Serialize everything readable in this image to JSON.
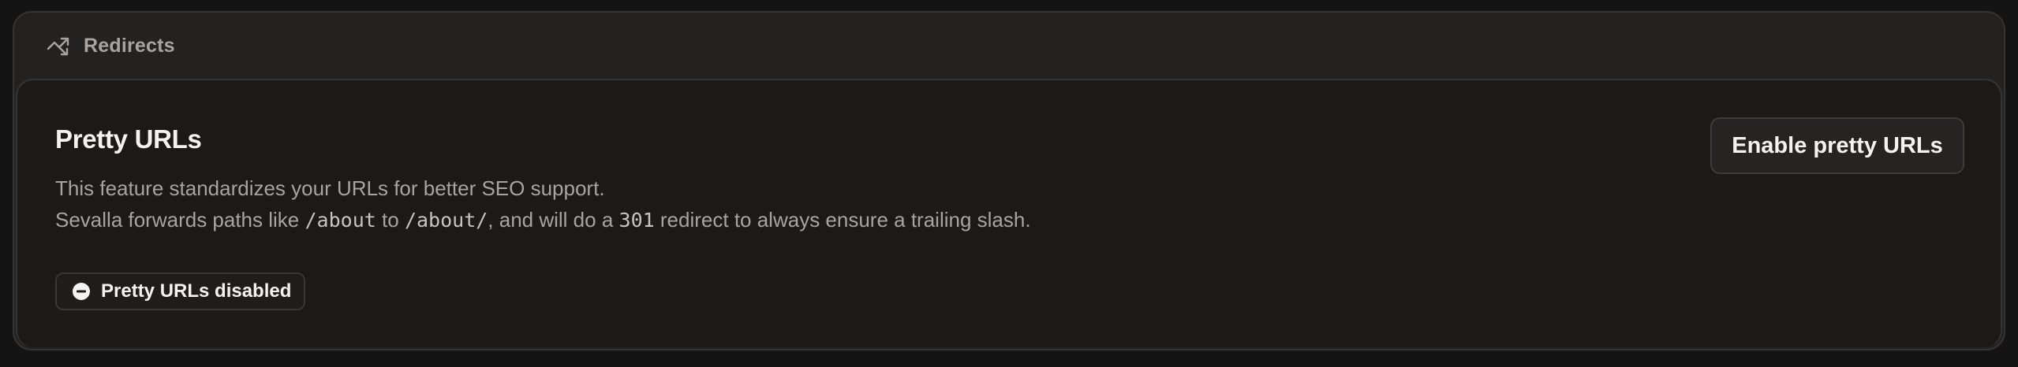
{
  "header": {
    "title": "Redirects",
    "icon": "redirect-arrows-icon"
  },
  "section": {
    "title": "Pretty URLs",
    "line1": "This feature standardizes your URLs for better SEO support.",
    "line2_part1": "Sevalla forwards paths like ",
    "line2_code1": "/about",
    "line2_part2": " to ",
    "line2_code2": "/about/",
    "line2_part3": ", and will do a ",
    "line2_code3": "301",
    "line2_part4": " redirect to always ensure a trailing slash."
  },
  "status": {
    "label": "Pretty URLs disabled",
    "icon": "minus-circle-icon",
    "color": "#f5f3f2"
  },
  "actions": {
    "enable_label": "Enable pretty URLs"
  },
  "colors": {
    "page_bg": "#141414",
    "card_bg": "#242121",
    "inner_bg": "#1c1917",
    "border": "#363333",
    "text_primary": "#f5f3f2",
    "text_secondary": "#a8a4a0"
  }
}
